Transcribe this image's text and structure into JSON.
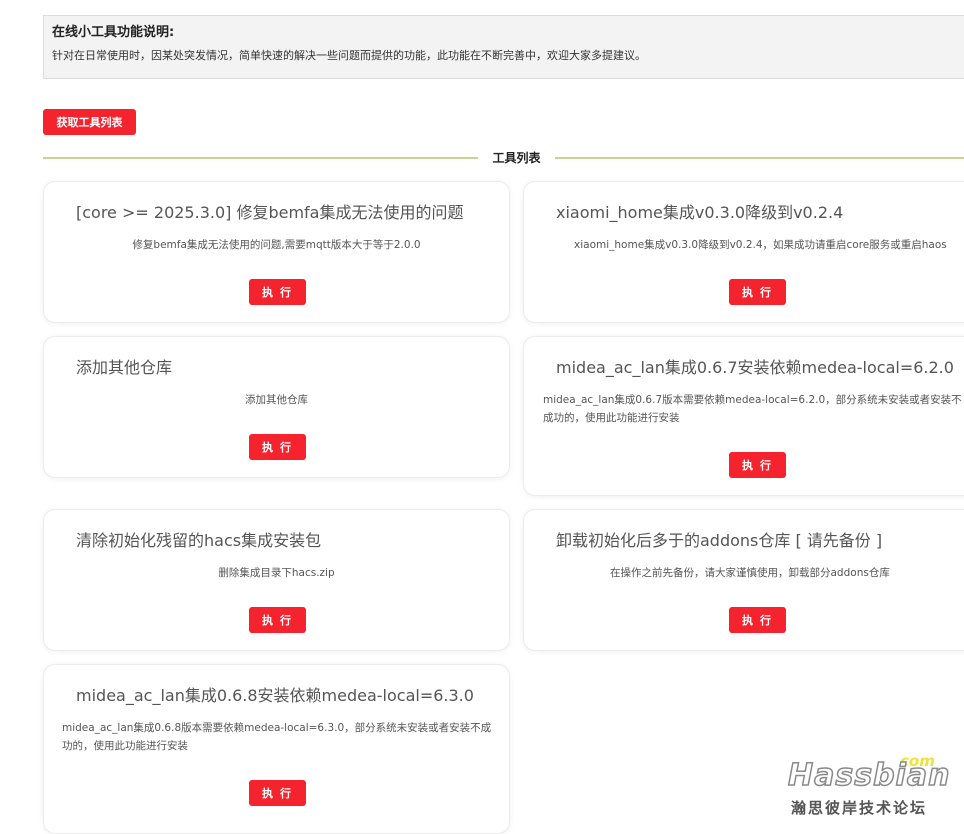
{
  "notice": {
    "title": "在线小工具功能说明:",
    "text": "针对在日常使用时，因某处突发情况，简单快速的解决一些问题而提供的功能，此功能在不断完善中，欢迎大家多提建议。"
  },
  "fetch_button": "获取工具列表",
  "section_title": "工具列表",
  "run_label": "执 行",
  "tools": [
    {
      "title": "[core >= 2025.3.0] 修复bemfa集成无法使用的问题",
      "desc": "修复bemfa集成无法使用的问题,需要mqtt版本大于等于2.0.0"
    },
    {
      "title": "xiaomi_home集成v0.3.0降级到v0.2.4",
      "desc": "xiaomi_home集成v0.3.0降级到v0.2.4，如果成功请重启core服务或重启haos"
    },
    {
      "title": "添加其他仓库",
      "desc": "添加其他仓库"
    },
    {
      "title": "midea_ac_lan集成0.6.7安装依赖medea-local=6.2.0",
      "desc": "midea_ac_lan集成0.6.7版本需要依赖medea-local=6.2.0，部分系统未安装或者安装不成功的，使用此功能进行安装"
    },
    {
      "title": "清除初始化残留的hacs集成安装包",
      "desc": "删除集成目录下hacs.zip"
    },
    {
      "title": "卸载初始化后多于的addons仓库 [ 请先备份 ]",
      "desc": "在操作之前先备份，请大家谨慎使用，卸载部分addons仓库"
    },
    {
      "title": "midea_ac_lan集成0.6.8安装依赖medea-local=6.3.0",
      "desc": "midea_ac_lan集成0.6.8版本需要依赖medea-local=6.3.0，部分系统未安装或者安装不成功的，使用此功能进行安装"
    }
  ],
  "watermark": {
    "logo": "Hassbian",
    "suffix": "com",
    "subtitle": "瀚思彼岸技术论坛"
  }
}
